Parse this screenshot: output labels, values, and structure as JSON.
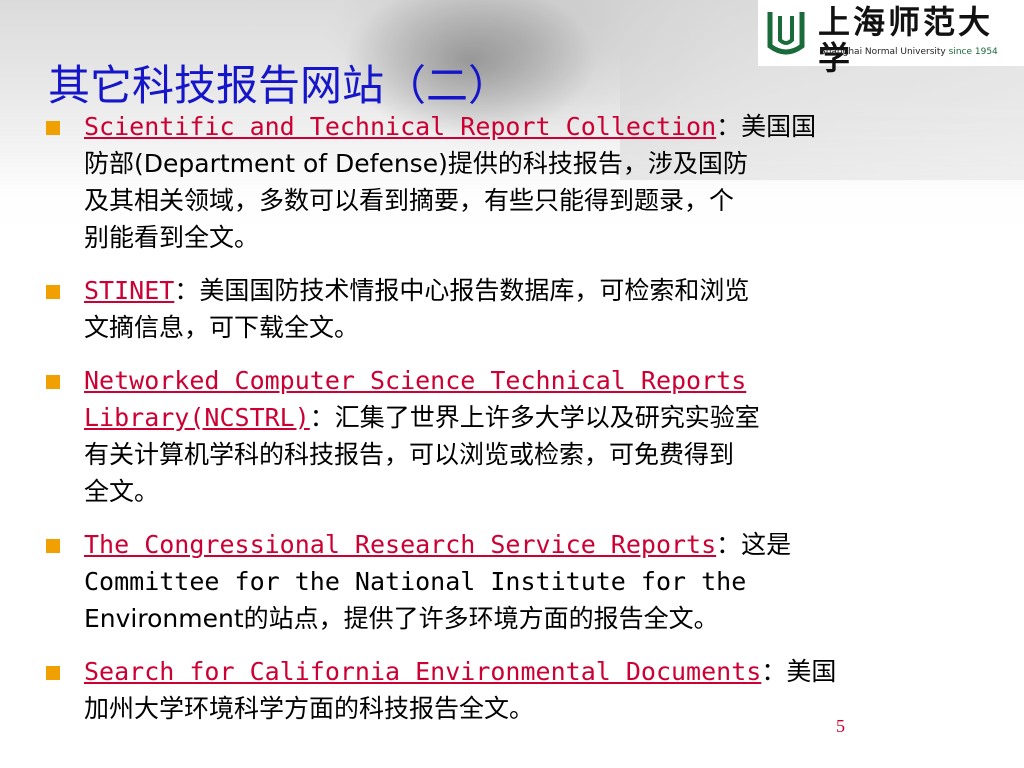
{
  "logo": {
    "cn_text": "上海师范大学",
    "en_text": "Shanghai Normal University",
    "since_text": "since 1954",
    "colors": {
      "mark": "#1a6b3a"
    }
  },
  "title": "其它科技报告网站（二）",
  "items": [
    {
      "link": "Scientific and Technical Report Collection",
      "line1_tail": "：美国国",
      "line2": "防部(Department of Defense)提供的科技报告，涉及国防",
      "line3": "及其相关领域，多数可以看到摘要，有些只能得到题录，个",
      "line4": "别能看到全文。"
    },
    {
      "link": "STINET",
      "line1_tail": "：美国国防技术情报中心报告数据库，可检索和浏览",
      "line2": "文摘信息，可下载全文。"
    },
    {
      "link_line1": "Networked Computer Science Technical Reports",
      "link_line2": "Library(NCSTRL)",
      "line2_tail": "：汇集了世界上许多大学以及研究实验室",
      "line3": "有关计算机学科的科技报告，可以浏览或检索，可免费得到",
      "line4": "全文。"
    },
    {
      "link": "The Congressional Research Service Reports",
      "line1_tail": "：这是",
      "line2": "Committee for the National Institute for the",
      "line3": "Environment的站点，提供了许多环境方面的报告全文。"
    },
    {
      "link": "Search for California Environmental Documents",
      "line1_tail": "：美国",
      "line2": "加州大学环境科学方面的科技报告全文。"
    }
  ],
  "page_number": "5",
  "colors": {
    "title": "#1515c9",
    "link": "#cc0033",
    "bullet": "#f0a000"
  }
}
